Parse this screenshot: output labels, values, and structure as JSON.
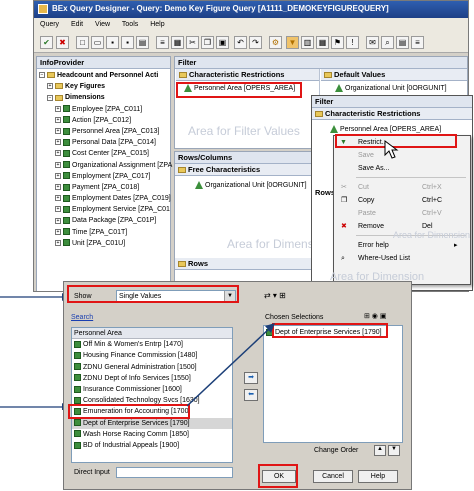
{
  "window": {
    "title": "BEx Query Designer - Query: Demo Key Figure Query [A1111_DEMOKEYFIGUREQUERY]",
    "menu": [
      "Query",
      "Edit",
      "View",
      "Tools",
      "Help"
    ]
  },
  "infoprovider": {
    "header": "InfoProvider",
    "root": "Headcount and Personnel Acti",
    "key_figures": "Key Figures",
    "dimensions": "Dimensions",
    "items": [
      "Employee [ZPA_C011]",
      "Action [ZPA_C012]",
      "Personnel Area [ZPA_C013]",
      "Personal Data [ZPA_C014]",
      "Cost Center [ZPA_C015]",
      "Organizational Assignment [ZPA",
      "Employment [ZPA_C017]",
      "Payment [ZPA_C018]",
      "Employment Dates [ZPA_C019]",
      "Employment Service [ZPA_C01",
      "Data Package [ZPA_C01P]",
      "Time [ZPA_C01T]",
      "Unit [ZPA_C01U]"
    ]
  },
  "filter": {
    "header": "Filter",
    "char_restrictions": "Characteristic Restrictions",
    "default_values": "Default Values",
    "restriction_item": "Personnel Area [OPERS_AREA]",
    "default_item": "Organizational Unit [0ORGUNIT]",
    "watermark": "Area for Filter Values"
  },
  "rows_columns": {
    "header": "Rows/Columns",
    "free_chars": "Free Characteristics",
    "free_item": "Organizational Unit [0ORGUNIT]",
    "watermark": "Area for Dimension",
    "rows": "Rows"
  },
  "popup": {
    "filter_header": "Filter",
    "char_restrictions": "Characteristic Restrictions",
    "item": "Personnel Area [OPERS_AREA]",
    "rows_partial": "Rows",
    "watermark": "Area for Dimension",
    "watermark2": "Area for Dimension",
    "menu": [
      {
        "label": "Restrict...",
        "shortcut": "",
        "disabled": false
      },
      {
        "label": "Save",
        "shortcut": "",
        "disabled": true
      },
      {
        "label": "Save As...",
        "shortcut": "",
        "disabled": false
      },
      {
        "label": "Cut",
        "shortcut": "Ctrl+X",
        "disabled": true
      },
      {
        "label": "Copy",
        "shortcut": "Ctrl+C",
        "disabled": false
      },
      {
        "label": "Paste",
        "shortcut": "Ctrl+V",
        "disabled": true
      },
      {
        "label": "Remove",
        "shortcut": "Del",
        "disabled": false
      },
      {
        "label": "Error help",
        "shortcut": "",
        "disabled": false
      },
      {
        "label": "Where-Used List",
        "shortcut": "",
        "disabled": false
      }
    ]
  },
  "dialog": {
    "show_label": "Show",
    "show_value": "Single Values",
    "search_link": "Search",
    "list_header": "Personnel Area",
    "values": [
      "Off Min & Women's Entrp [1470]",
      "Housing Finance Commission [1480]",
      "ZDNU General Administration [1500]",
      "ZDNU Dept of Info Services [1550]",
      "Insurance Commissioner [1600]",
      "Consolidated Technology Svcs [1630]",
      "Emuneration for Accounting [1700]",
      "Dept of Enterprise Services [1790]",
      "Wash Horse Racing Comm [1850]",
      "BD of Industrial Appeals [1900]"
    ],
    "chosen_header": "Chosen Selections",
    "chosen_value": "Dept of Enterprise Services [1790]",
    "direct_input_label": "Direct Input",
    "change_order": "Change Order",
    "ok": "OK",
    "cancel": "Cancel",
    "help": "Help"
  }
}
